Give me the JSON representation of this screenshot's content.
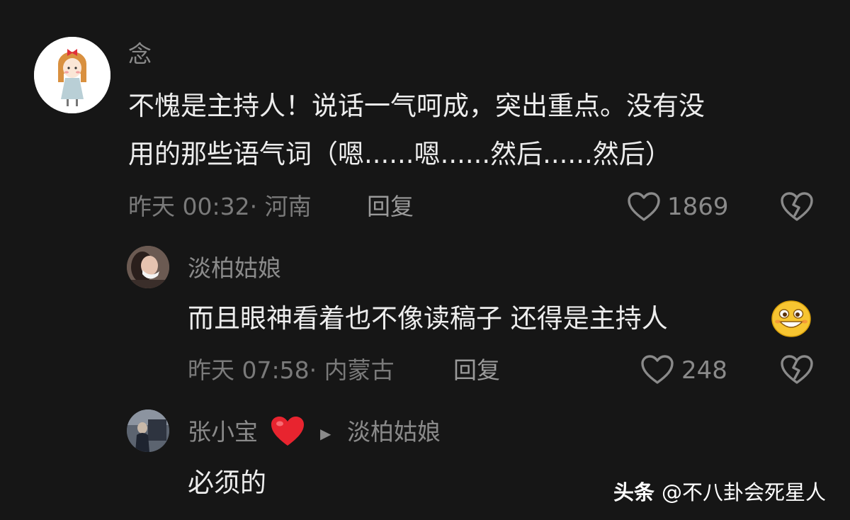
{
  "comments": [
    {
      "author": "念",
      "text_lines": [
        "不愧是主持人！说话一气呵成，突出重点。没有没",
        "用的那些语气词（嗯......嗯......然后......然后）"
      ],
      "time_location": "昨天 00:32· 河南",
      "reply_label": "回复",
      "like_count": "1869",
      "avatar_icon": "cartoon-girl-avatar"
    }
  ],
  "replies": [
    {
      "author": "淡柏姑娘",
      "text": "而且眼神看着也不像读稿子  还得是主持人",
      "emoji": "grinning-face-emoji",
      "time_location": "昨天 07:58· 内蒙古",
      "reply_label": "回复",
      "like_count": "248"
    },
    {
      "author": "张小宝",
      "author_badge": "red-heart-emoji",
      "reply_arrow": "▶",
      "reply_to": "淡柏姑娘",
      "text": "必须的"
    }
  ],
  "watermark": {
    "brand": "头条",
    "handle": "@不八卦会死星人"
  },
  "colors": {
    "background": "#161616",
    "text": "#ededed",
    "muted": "#8a8a8a"
  }
}
